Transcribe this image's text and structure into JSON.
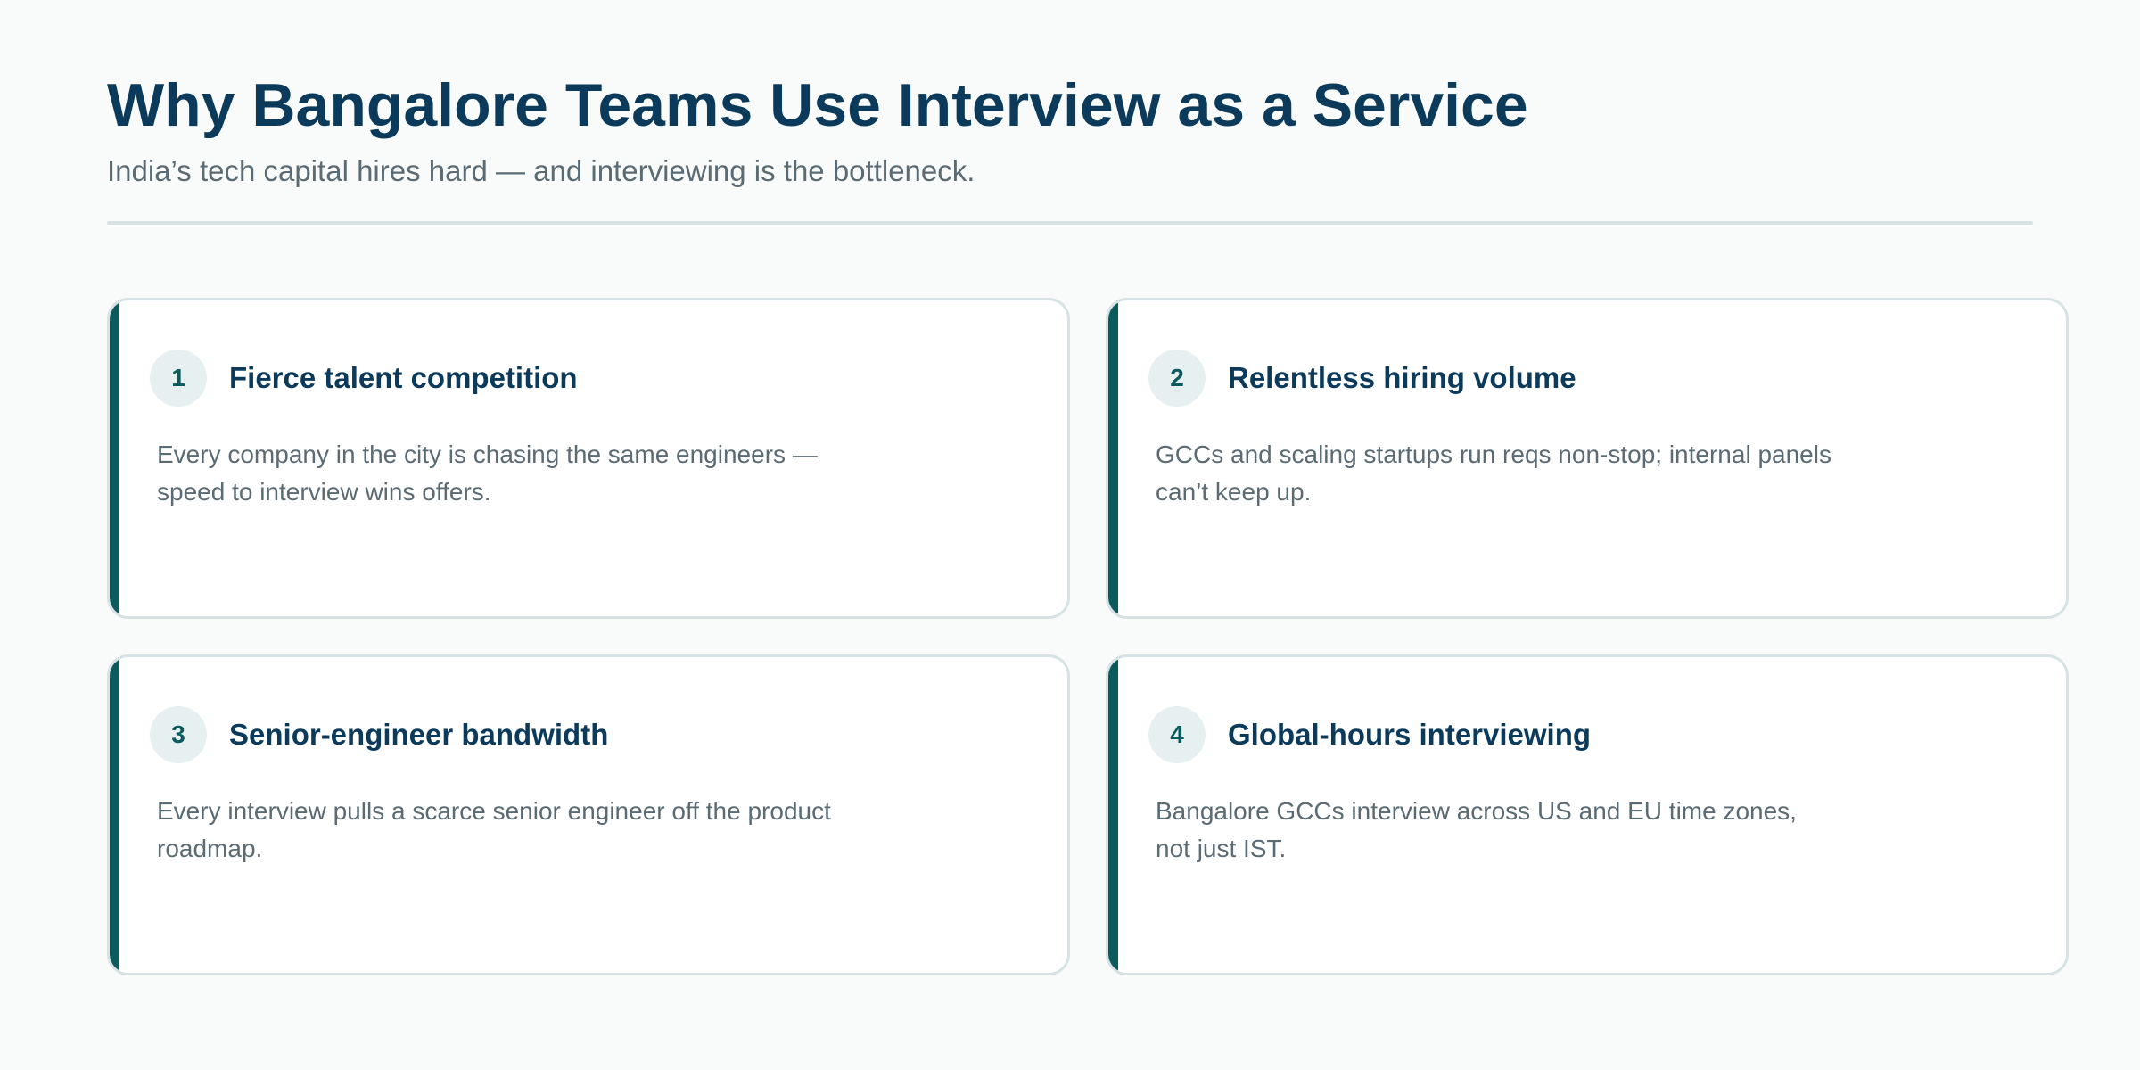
{
  "header": {
    "title": "Why Bangalore Teams Use Interview as a Service",
    "subtitle": "India’s tech capital hires hard — and interviewing is the bottleneck."
  },
  "cards": [
    {
      "number": "1",
      "title": "Fierce talent competition",
      "description": "Every company in the city is chasing the same engineers — speed to interview wins offers."
    },
    {
      "number": "2",
      "title": "Relentless hiring volume",
      "description": "GCCs and scaling startups run reqs non-stop; internal panels can’t keep up."
    },
    {
      "number": "3",
      "title": "Senior-engineer bandwidth",
      "description": "Every interview pulls a scarce senior engineer off the product roadmap."
    },
    {
      "number": "4",
      "title": "Global-hours interviewing",
      "description": "Bangalore GCCs interview across US and EU time zones, not just IST."
    }
  ],
  "colors": {
    "title": "#0b3a5b",
    "accent": "#0b5a5e",
    "text_muted": "#5b6b74",
    "border": "#d6e2e3",
    "badge_bg": "#e6f0f0",
    "background": "#f9fbfb"
  }
}
